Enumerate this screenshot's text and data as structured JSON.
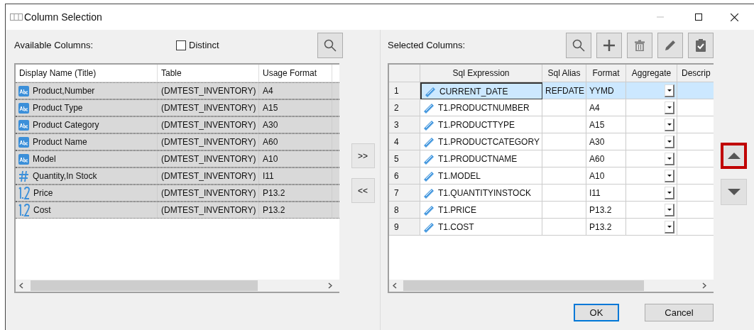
{
  "window": {
    "title": "Column Selection"
  },
  "available": {
    "label": "Available Columns:",
    "distinct": {
      "label": "Distinct",
      "checked": false
    },
    "columns": [
      "Display Name (Title)",
      "Table",
      "Usage Format"
    ],
    "rows": [
      {
        "kind": "text",
        "name": "Product,Number",
        "table": "(DMTEST_INVENTORY)",
        "format": "A4",
        "selected": true
      },
      {
        "kind": "text",
        "name": "Product Type",
        "table": "(DMTEST_INVENTORY)",
        "format": "A15",
        "selected": true
      },
      {
        "kind": "text",
        "name": "Product Category",
        "table": "(DMTEST_INVENTORY)",
        "format": "A30",
        "selected": true
      },
      {
        "kind": "text",
        "name": "Product Name",
        "table": "(DMTEST_INVENTORY)",
        "format": "A60",
        "selected": true
      },
      {
        "kind": "text",
        "name": "Model",
        "table": "(DMTEST_INVENTORY)",
        "format": "A10",
        "selected": true
      },
      {
        "kind": "integer",
        "name": "Quantity,In Stock",
        "table": "(DMTEST_INVENTORY)",
        "format": "I11",
        "selected": true
      },
      {
        "kind": "decimal",
        "name": "Price",
        "table": "(DMTEST_INVENTORY)",
        "format": "P13.2",
        "selected": true
      },
      {
        "kind": "decimal",
        "name": "Cost",
        "table": "(DMTEST_INVENTORY)",
        "format": "P13.2",
        "selected": true
      }
    ]
  },
  "transfer_buttons": [
    ">>",
    "<<"
  ],
  "selected": {
    "label": "Selected Columns:",
    "columns": [
      "Sql Expression",
      "Sql Alias",
      "Format",
      "Aggregate",
      "Descrip"
    ],
    "rows": [
      {
        "number": "1",
        "expression": "CURRENT_DATE",
        "alias": "REFDATE",
        "format": "YYMD",
        "selected": true
      },
      {
        "number": "2",
        "expression": "T1.PRODUCTNUMBER",
        "format": "A4",
        "selected": false
      },
      {
        "number": "3",
        "expression": "T1.PRODUCTTYPE",
        "format": "A15",
        "selected": false
      },
      {
        "number": "4",
        "expression": "T1.PRODUCTCATEGORY",
        "format": "A30",
        "selected": false
      },
      {
        "number": "5",
        "expression": "T1.PRODUCTNAME",
        "format": "A60",
        "selected": false
      },
      {
        "number": "6",
        "expression": "T1.MODEL",
        "format": "A10",
        "selected": false
      },
      {
        "number": "7",
        "expression": "T1.QUANTITYINSTOCK",
        "format": "I11",
        "selected": false
      },
      {
        "number": "8",
        "expression": "T1.PRICE",
        "format": "P13.2",
        "selected": false
      },
      {
        "number": "9",
        "expression": "T1.COST",
        "format": "P13.2",
        "selected": false
      }
    ]
  },
  "move_buttons": [
    {
      "kind": "up",
      "highlighted": true
    },
    {
      "kind": "down",
      "highlighted": false
    }
  ],
  "buttons": [
    {
      "label": "OK",
      "default": true
    },
    {
      "label": "Cancel",
      "default": false
    }
  ]
}
